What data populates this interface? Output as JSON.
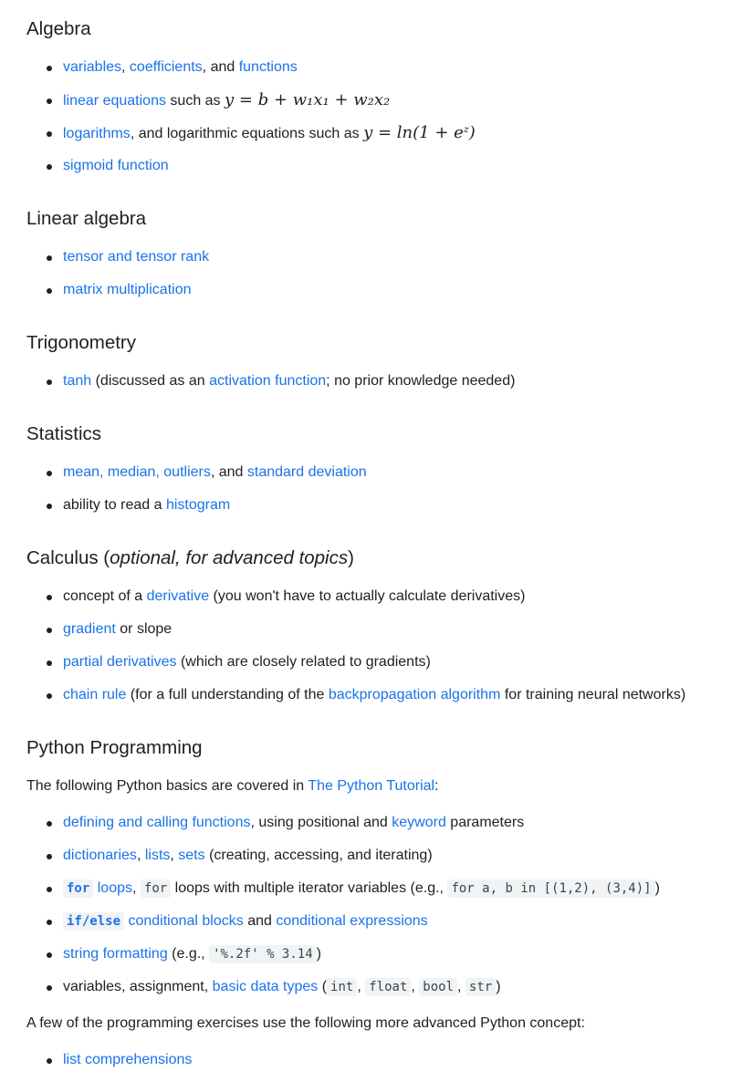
{
  "algebra": {
    "heading": "Algebra",
    "i1": {
      "l1": "variables",
      "t1": ", ",
      "l2": "coefficients",
      "t2": ", and ",
      "l3": "functions"
    },
    "i2": {
      "l1": "linear equations",
      "t1": " such as ",
      "math": "y = b + w₁x₁ + w₂x₂"
    },
    "i3": {
      "l1": "logarithms",
      "t1": ", and logarithmic equations such as ",
      "math": "y = ln(1 + eᶻ)"
    },
    "i4": {
      "l1": "sigmoid function"
    }
  },
  "linalg": {
    "heading": "Linear algebra",
    "i1": {
      "l1": "tensor and tensor rank"
    },
    "i2": {
      "l1": "matrix multiplication"
    }
  },
  "trig": {
    "heading": "Trigonometry",
    "i1": {
      "l1": "tanh",
      "t1": " (discussed as an ",
      "l2": "activation function",
      "t2": "; no prior knowledge needed)"
    }
  },
  "stats": {
    "heading": "Statistics",
    "i1": {
      "l1": "mean, median, outliers",
      "t1": ", and ",
      "l2": "standard deviation"
    },
    "i2": {
      "t0": "ability to read a ",
      "l1": "histogram"
    }
  },
  "calc": {
    "heading": "Calculus (",
    "heading_em": "optional, for advanced topics",
    "heading_end": ")",
    "i1": {
      "t0": "concept of a ",
      "l1": "derivative",
      "t1": " (you won't have to actually calculate derivatives)"
    },
    "i2": {
      "l1": "gradient",
      "t1": " or slope"
    },
    "i3": {
      "l1": "partial derivatives",
      "t1": " (which are closely related to gradients)"
    },
    "i4": {
      "l1": "chain rule",
      "t1": " (for a full understanding of the ",
      "l2": "backpropagation algorithm",
      "t2": " for training neural networks)"
    }
  },
  "python": {
    "heading": "Python Programming",
    "intro": {
      "t0": "The following Python basics are covered in ",
      "l1": "The Python Tutorial",
      "t1": ":"
    },
    "i1": {
      "l1": "defining and calling functions",
      "t1": ", using positional and ",
      "l2": "keyword",
      "t2": " parameters"
    },
    "i2": {
      "l1": "dictionaries",
      "t1": ", ",
      "l2": "lists",
      "t2": ", ",
      "l3": "sets",
      "t3": " (creating, accessing, and iterating)"
    },
    "i3": {
      "c1": "for",
      "l1": " loops",
      "t1": ", ",
      "c2": "for",
      "t2": " loops with multiple iterator variables (e.g., ",
      "c3": "for a, b in [(1,2), (3,4)]",
      "t3": ")"
    },
    "i4": {
      "c1": "if/else",
      "l1": " conditional blocks",
      "t1": " and ",
      "l2": "conditional expressions"
    },
    "i5": {
      "l1": "string formatting",
      "t1": " (e.g., ",
      "c1": "'%.2f' % 3.14",
      "t2": ")"
    },
    "i6": {
      "t0": "variables, assignment, ",
      "l1": "basic data types",
      "t1": " (",
      "c1": "int",
      "t2": ", ",
      "c2": "float",
      "t3": ", ",
      "c3": "bool",
      "t4": ", ",
      "c4": "str",
      "t5": ")"
    },
    "outro": "A few of the programming exercises use the following more advanced Python concept:",
    "i7": {
      "l1": "list comprehensions"
    }
  },
  "colors": {
    "link": "#1a73e8",
    "text": "#202124",
    "code_bg": "#f1f3f4"
  }
}
